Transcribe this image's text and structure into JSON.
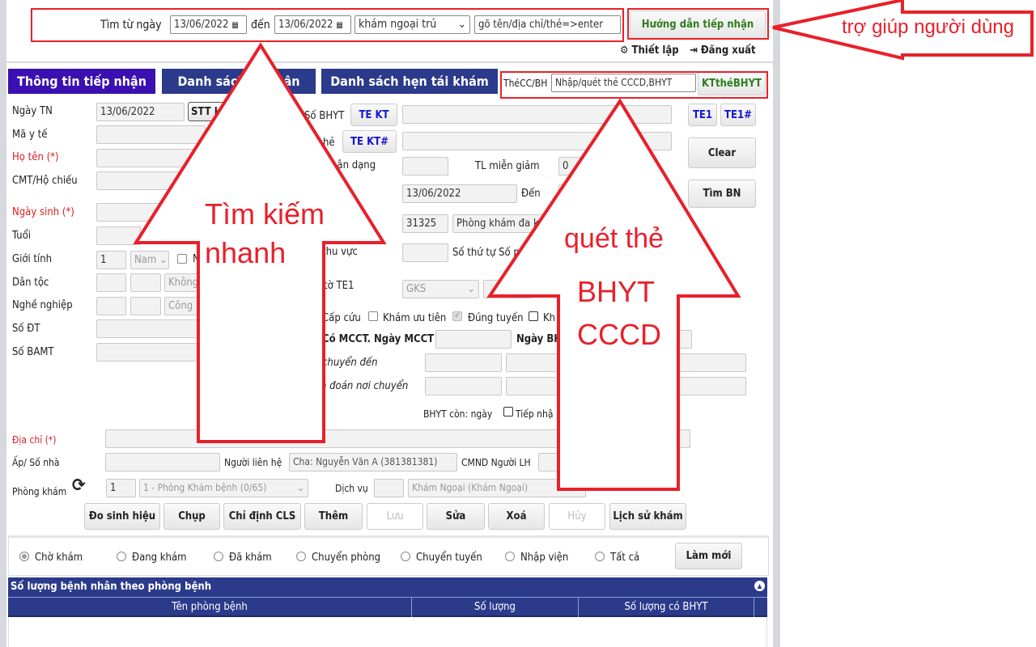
{
  "search": {
    "from_label": "Tìm từ ngày",
    "from_date": "13/06/2022",
    "to_label": "đến",
    "to_date": "13/06/2022",
    "type_select": "khám ngoại trú",
    "query_placeholder": "gõ tên/địa chỉ/thẻ=>enter"
  },
  "header": {
    "help_button": "Hướng dẫn tiếp nhận",
    "settings": "Thiết lập",
    "logout": "Đăng xuất"
  },
  "tabs": [
    {
      "label": "Thông tin tiếp nhận",
      "active": true
    },
    {
      "label": "Danh sách ... nhận"
    },
    {
      "label": "Danh sách hẹn tái khám"
    }
  ],
  "card": {
    "label": "ThéCC/BH",
    "placeholder": "Nhập/quét thẻ CCCD,BHYT",
    "check_button": "KTthéBHYT"
  },
  "form": {
    "left_labels": [
      "Ngày TN",
      "Mã y tế",
      "Họ tên (*)",
      "CMT/Hộ chiếu",
      "Ngày sinh (*)",
      "Tuổi",
      "Giới tính",
      "Dân tộc",
      "Nghề nghiệp",
      "Số ĐT",
      "Số BAMT"
    ],
    "ngay_tn": "13/06/2022",
    "stt_button": "STT k",
    "gioi_tinh_code": "1",
    "gioi_tinh": "Nam",
    "gioi_tinh_extra": "N",
    "dan_toc": "Không",
    "nghe_nghiep": "Công",
    "mid_labels": {
      "so_bhyt": "Số BHYT",
      "the": "hẻ",
      "nhan_dang": "hận dạng",
      "khu_vuc": "thu vực",
      "to_te1": "tờ TE1",
      "cap_cuu": "Cấp cứu",
      "mcct": "Có MCCT. Ngày MCCT",
      "chuyen_den": "chuyển đến",
      "chan_doan": "n đoán nơi chuyển"
    },
    "te_kt": "TE KT",
    "te_kt_hash": "TE KT#",
    "te1": "TE1",
    "te1_hash": "TE1#",
    "clear": "Clear",
    "tim_bn": "Tìm BN",
    "tl_mien_giam_label": "TL miễn giảm",
    "tl_mien_giam": "0",
    "from_date": "13/06/2022",
    "den_label": "Đến",
    "ma_kcb": "31325",
    "noi_kcb": "Phòng khám đa kh",
    "so_thu_tu": "Số thứ tự Số ph",
    "giay_to": "GKS",
    "kham_uu_tien": "Khám ưu tiên",
    "dung_tuyen": "Đúng tuyến",
    "dung_tuyen_checked": true,
    "kha": "Kh",
    "ngay_bh": "Ngày BH",
    "bhyt_con": "BHYT còn: ngày",
    "tiep_nhan": "Tiếp nhậ",
    "dia_chi_label": "Địa chỉ (*)",
    "ap_label": "Ấp/ Số nhà",
    "nguoi_lh_label": "Người liên hệ",
    "nguoi_lh_placeholder": "Cha: Nguyễn Văn A (381381381)",
    "cmnd_lh_label": "CMND Người LH",
    "phong_kham_label": "Phòng khám",
    "phong_kham_code": "1",
    "phong_kham": "1 - Phòng Khám bệnh (0/65)",
    "dich_vu_label": "Dịch vụ",
    "dich_vu": "Khám Ngoại (Khám Ngoại)"
  },
  "actions": [
    "Đo sinh hiệu",
    "Chụp",
    "Chỉ định CLS",
    "Thêm",
    "Lưu",
    "Sửa",
    "Xoá",
    "Hủy",
    "Lịch sử khám"
  ],
  "filters": {
    "options": [
      "Chờ khám",
      "Đang khám",
      "Đã khám",
      "Chuyển phòng",
      "Chuyển tuyến",
      "Nhập viện",
      "Tất cả"
    ],
    "selected": "Chờ khám",
    "refresh": "Làm mới"
  },
  "table": {
    "title": "Số lượng bệnh nhân theo phòng bệnh",
    "columns": [
      "Tên phòng bệnh",
      "Số lượng",
      "Số lượng có BHYT"
    ],
    "rows": []
  },
  "annotations": {
    "help": "trợ giúp người dùng",
    "search_1": "Tìm kiếm",
    "search_2": "nhanh",
    "scan_1": "quét thẻ",
    "scan_2": "BHYT",
    "scan_3": "CCCD"
  },
  "colors": {
    "tab_active": "#3a10b0",
    "tab": "#2b3a8a",
    "annotation": "#e8202a",
    "required": "#d62020",
    "help_text": "#2e7d1e"
  }
}
